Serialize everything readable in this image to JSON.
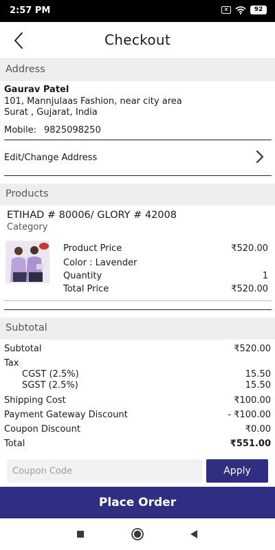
{
  "status_bar": {
    "time": "2:57 PM",
    "battery": "92"
  },
  "header": {
    "title": "Checkout"
  },
  "address": {
    "section_label": "Address",
    "name": "Gaurav Patel",
    "line1": "101, Mannjulaas Fashion, near city area",
    "line2": "Surat , Gujarat, India",
    "mobile_label": "Mobile:",
    "mobile_value": "9825098250",
    "edit_label": "Edit/Change Address"
  },
  "products": {
    "section_label": "Products",
    "items": [
      {
        "title": "ETIHAD #  80006/ GLORY # 42008",
        "category": "Category",
        "price_label": "Product Price",
        "price_value": "₹520.00",
        "color_label": "Color : Lavender",
        "quantity_label": "Quantity",
        "quantity_value": "1",
        "total_label": "Total Price",
        "total_value": "₹520.00"
      }
    ]
  },
  "subtotal": {
    "section_label": "Subtotal",
    "rows": [
      {
        "label": "Subtotal",
        "value": "₹520.00"
      },
      {
        "label": "Tax",
        "value": ""
      },
      {
        "label": "CGST (2.5%)",
        "value": "15.50"
      },
      {
        "label": "SGST (2.5%)",
        "value": "15.50"
      },
      {
        "label": "Shipping Cost",
        "value": "₹100.00"
      },
      {
        "label": "Payment Gateway Discount",
        "value": "- ₹100.00"
      },
      {
        "label": "Coupon Discount",
        "value": "₹0.00"
      },
      {
        "label": "Total",
        "value": "₹551.00"
      }
    ]
  },
  "coupon": {
    "placeholder": "Coupon Code",
    "apply_label": "Apply"
  },
  "footer": {
    "place_order_label": "Place Order"
  },
  "colors": {
    "primary": "#2f2e83",
    "section_bg": "#eeeeee"
  },
  "icons": {
    "back": "back-arrow-icon",
    "chevron": "chevron-right-icon",
    "nav_recents": "square-icon",
    "nav_home": "circle-icon",
    "nav_back": "triangle-back-icon"
  }
}
